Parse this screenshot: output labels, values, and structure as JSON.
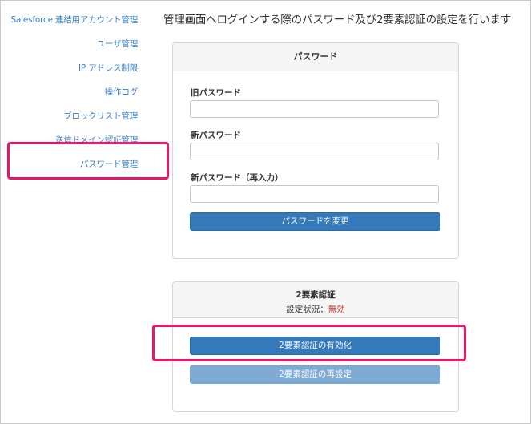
{
  "sidebar": {
    "items": [
      {
        "label": "Salesforce 連結用アカウント管理"
      },
      {
        "label": "ユーザ管理"
      },
      {
        "label": "IP アドレス制限"
      },
      {
        "label": "操作ログ"
      },
      {
        "label": "ブロックリスト管理"
      },
      {
        "label": "送信ドメイン認証管理"
      },
      {
        "label": "パスワード管理"
      }
    ]
  },
  "page": {
    "title": "管理画面へログインする際のパスワード及び2要素認証の設定を行います"
  },
  "password_panel": {
    "heading": "パスワード",
    "old_label": "旧パスワード",
    "new_label": "新パスワード",
    "confirm_label": "新パスワード（再入力）",
    "submit_label": "パスワードを変更"
  },
  "twofa_panel": {
    "heading": "2要素認証",
    "status_prefix": "設定状況：",
    "status_value": "無効",
    "enable_label": "2要素認証の有効化",
    "reset_label": "2要素認証の再設定"
  },
  "colors": {
    "link": "#3a7fc4",
    "primary": "#3479b9",
    "disabled": "#7eaad4",
    "status_off": "#c0392b",
    "highlight": "#e8176a"
  }
}
